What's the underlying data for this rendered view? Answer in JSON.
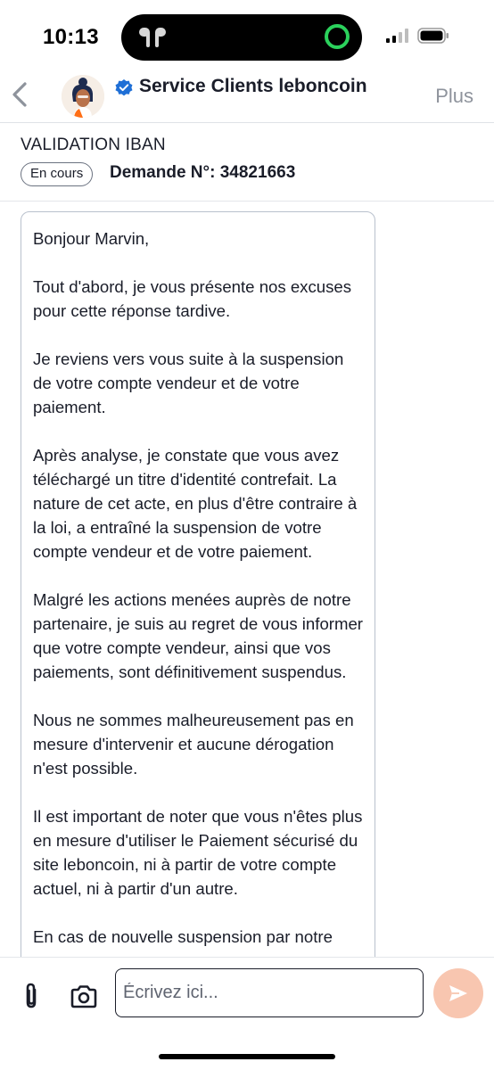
{
  "status_bar": {
    "time": "10:13"
  },
  "header": {
    "title": "Service Clients leboncoin",
    "more_label": "Plus"
  },
  "ticket": {
    "title": "VALIDATION IBAN",
    "status": "En cours",
    "request_number": "Demande N°: 34821663"
  },
  "message": {
    "paragraphs": [
      "Bonjour Marvin,",
      "Tout d'abord, je vous présente nos excuses pour cette réponse tardive.",
      "Je reviens vers vous suite à la suspension de votre compte vendeur et de votre paiement.",
      "Après analyse, je constate que vous avez téléchargé un titre d'identité contrefait. La nature de cet acte, en plus d'être contraire à la loi, a entraîné la suspension de votre compte vendeur et de votre paiement.",
      "Malgré les actions menées auprès de notre partenaire, je suis au regret de vous informer que votre compte vendeur, ainsi que vos paiements, sont définitivement suspendus.",
      "Nous ne sommes malheureusement pas en mesure d'intervenir et aucune dérogation n'est possible.",
      "Il est important de noter que vous n'êtes plus en mesure d'utiliser le Paiement sécurisé du site leboncoin, ni à partir de votre compte actuel, ni à partir d'un autre.",
      "En cas de nouvelle suspension par notre"
    ]
  },
  "composer": {
    "placeholder": "Écrivez ici..."
  },
  "icons": {
    "back": "chevron-left-icon",
    "verified": "verified-badge-icon",
    "attach": "paperclip-icon",
    "camera": "camera-icon",
    "send": "send-icon"
  },
  "colors": {
    "send_button": "#f8c6b0",
    "verified": "#1f6fd6",
    "island_indicator": "#2bd15c"
  }
}
